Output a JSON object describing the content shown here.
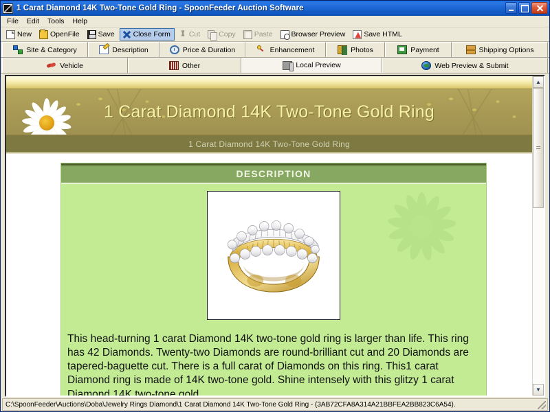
{
  "window": {
    "title": "1 Carat Diamond 14K Two-Tone Gold Ring - SpoonFeeder Auction Software",
    "icon": "app-icon",
    "minimize_label": "",
    "maximize_label": "",
    "close_label": ""
  },
  "menu": {
    "items": [
      {
        "label": "File"
      },
      {
        "label": "Edit"
      },
      {
        "label": "Tools"
      },
      {
        "label": "Help"
      }
    ]
  },
  "toolbar": {
    "buttons": [
      {
        "label": "New",
        "icon": "new-page-icon",
        "state": "enabled"
      },
      {
        "label": "OpenFile",
        "icon": "open-folder-icon",
        "state": "enabled"
      },
      {
        "label": "Save",
        "icon": "floppy-disk-icon",
        "state": "enabled"
      },
      {
        "label": "Close Form",
        "icon": "close-x-icon",
        "state": "active"
      },
      {
        "label": "Cut",
        "icon": "scissors-icon",
        "state": "disabled"
      },
      {
        "label": "Copy",
        "icon": "copy-pages-icon",
        "state": "disabled"
      },
      {
        "label": "Paste",
        "icon": "clipboard-icon",
        "state": "disabled"
      },
      {
        "label": "Browser Preview",
        "icon": "magnify-page-icon",
        "state": "enabled"
      },
      {
        "label": "Save HTML",
        "icon": "save-html-icon",
        "state": "enabled"
      }
    ]
  },
  "tabs_row1": [
    {
      "label": "Site & Category",
      "icon": "sitemap-icon",
      "selected": false
    },
    {
      "label": "Description",
      "icon": "notepad-pencil-icon",
      "selected": false
    },
    {
      "label": "Price & Duration",
      "icon": "clock-icon",
      "selected": false
    },
    {
      "label": "Enhancement",
      "icon": "magic-wand-icon",
      "selected": false
    },
    {
      "label": "Photos",
      "icon": "photo-icon",
      "selected": false
    },
    {
      "label": "Payment",
      "icon": "money-icon",
      "selected": false
    },
    {
      "label": "Shipping Options",
      "icon": "package-box-icon",
      "selected": false
    }
  ],
  "tabs_row2": [
    {
      "label": "Vehicle",
      "icon": "car-icon",
      "selected": false
    },
    {
      "label": "Other",
      "icon": "barcode-icon",
      "selected": false
    },
    {
      "label": "Local Preview",
      "icon": "window-preview-icon",
      "selected": true
    },
    {
      "label": "Web Preview & Submit",
      "icon": "globe-icon",
      "selected": false
    }
  ],
  "preview": {
    "banner_title": "1 Carat Diamond 14K Two-Tone Gold Ring",
    "banner_subtitle": "1 Carat Diamond 14K Two-Tone Gold Ring",
    "section_heading": "DESCRIPTION",
    "photo_alt": "diamond-ring-photo",
    "body_text": "This head-turning 1 carat Diamond 14K two-tone gold ring is larger than life. This ring has 42 Diamonds. Twenty-two Diamonds are round-brilliant cut and 20 Diamonds are tapered-baguette cut. There is a full carat of Diamonds on this ring. This1 carat Diamond ring is made of 14K two-tone gold. Shine intensely with this glitzy 1 carat Diamond 14K two-tone gold"
  },
  "statusbar": {
    "text": "C:\\SpoonFeeder\\Auctions\\Doba\\Jewelry Rings Diamond\\1 Carat Diamond 14K Two-Tone Gold Ring - (3AB72CFA8A314A21BBFEA2BB823C6A54)."
  },
  "colors": {
    "titlebar_blue": "#1d6ad8",
    "banner_olive": "#a89a55",
    "banner_title_yellow": "#f7f0a8",
    "subtitle_olive": "#7e7940",
    "desc_green_bg": "#c2eb94",
    "desc_header_green": "#86a861",
    "toolbar_active": "#b5ccea"
  }
}
